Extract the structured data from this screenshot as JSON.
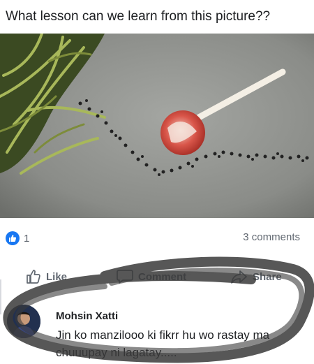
{
  "post": {
    "text": "What lesson can we learn from this picture??",
    "photo": "ants-trail-around-lollipop"
  },
  "stats": {
    "reaction_icon": "like-icon",
    "reaction_count": "1",
    "comments_label": "3 comments"
  },
  "actions": {
    "like_label": "Like",
    "comment_label": "Comment",
    "share_label": "Share"
  },
  "comment": {
    "author": "Mohsin Xatti",
    "text": "Jin ko manzilooo ki fikrr hu wo rastay ma chuuupay ni lagatay....."
  },
  "colors": {
    "accent": "#1877f2",
    "text": "#1c1e21",
    "muted": "#606770"
  }
}
